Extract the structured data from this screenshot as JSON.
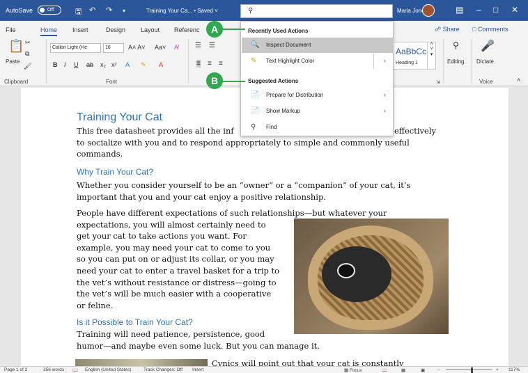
{
  "titlebar": {
    "autosave_label": "AutoSave",
    "autosave_state": "Off",
    "doc_title": "Training Your Ca... • Saved ˅",
    "user_name": "Maria Jones",
    "accent_color": "#2b579a"
  },
  "search": {
    "value": "",
    "placeholder": ""
  },
  "tabs": [
    "File",
    "Home",
    "Insert",
    "Design",
    "Layout",
    "Referenc"
  ],
  "active_tab": "Home",
  "share_label": "Share",
  "comments_label": "Comments",
  "ribbon": {
    "clipboard_label": "Clipboard",
    "paste_label": "Paste",
    "font_label": "Font",
    "font_name": "Calibri Light (He",
    "font_size": "16",
    "style_sample": "AaBbCc",
    "style_name": "Heading 1",
    "editing_label": "Editing",
    "dictate_label": "Dictate",
    "voice_label": "Voice"
  },
  "dropdown": {
    "recent_header": "Recently Used Actions",
    "recent_items": [
      {
        "icon": "inspect-document-icon",
        "label": "Inspect Document",
        "arrow": ""
      },
      {
        "icon": "highlighter-icon",
        "label": "Text Highlight Color",
        "arrow": "›"
      }
    ],
    "suggested_header": "Suggested Actions",
    "suggested_items": [
      {
        "icon": "prepare-distribution-icon",
        "label": "Prepare for Distribution",
        "arrow": "›"
      },
      {
        "icon": "show-markup-icon",
        "label": "Show Markup",
        "arrow": "›"
      },
      {
        "icon": "find-icon",
        "label": "Find",
        "arrow": ""
      }
    ]
  },
  "callouts": {
    "a": "A",
    "b": "B",
    "color": "#2fa84f"
  },
  "document": {
    "title": "Training Your Cat",
    "intro_lines": [
      "This free datasheet provides all the inf",
      "to socialize with you and to respond appropriately to simple and commonly useful",
      "commands."
    ],
    "intro_tail": "effectively",
    "h_why": "Why Train Your Cat?",
    "why_lines": [
      "Whether you consider yourself to be an “owner” or a “companion” of your cat, it’s",
      "important that you and your cat enjoy a positive relationship."
    ],
    "people_first": "People have different expectations of such relationships—but whatever your",
    "people_lines": [
      "expectations, you will almost certainly need to",
      "get your cat to take actions you want. For",
      "example, you may need your cat to come to you",
      "so you can put on or adjust its collar, or you may",
      "need your cat to enter a travel basket for a trip to",
      "the vet’s without resistance or distress—going to",
      "the vet’s will be much easier with a cooperative",
      "or feline."
    ],
    "h_possible": "Is it Possible to Train Your Cat?",
    "possible_lines": [
      "Training will need patience, persistence, good",
      "humor—and maybe even some luck. But you can manage it."
    ],
    "cynics_line": "Cynics will point out that your cat is constantly"
  },
  "statusbar": {
    "page": "Page 1 of 2",
    "words": "356 words",
    "language": "English (United States)",
    "track_changes": "Track Changes: Off",
    "mode": "Insert",
    "focus": "Focus",
    "zoom": "117%"
  }
}
